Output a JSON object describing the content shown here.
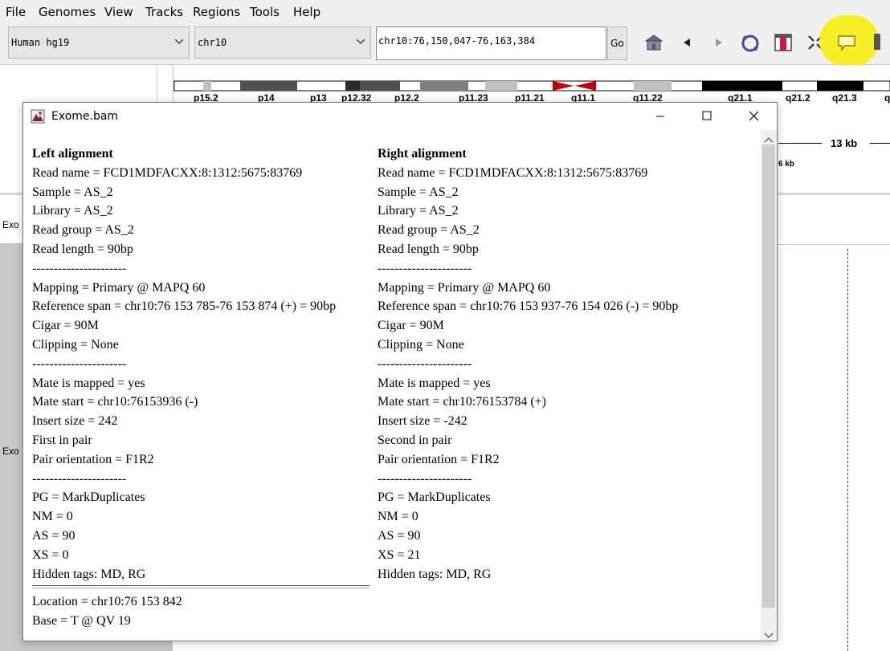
{
  "menu": [
    "File",
    "Genomes",
    "View",
    "Tracks",
    "Regions",
    "Tools",
    "Help"
  ],
  "toolbar": {
    "genome": "Human hg19",
    "chromosome": "chr10",
    "locus": "chr10:76,150,047-76,163,384",
    "go_label": "Go",
    "icons": [
      "home-icon",
      "back-icon",
      "forward-icon",
      "refresh-icon",
      "region-of-interest-icon",
      "resize-icon",
      "popup-info-icon"
    ]
  },
  "ideogram": {
    "bands": [
      "p15.2",
      "p14",
      "p13",
      "p12.32",
      "p12.2",
      "p11.23",
      "p11.21",
      "q11.1",
      "q11.22",
      "q21.1",
      "q21.2",
      "q21.3",
      "q"
    ],
    "ruler_label": "13 kb",
    "ruler_tick": "6 kb"
  },
  "tracks": {
    "left_label_1": "Exo",
    "left_label_2": "Exo"
  },
  "popup": {
    "title": "Exome.bam",
    "left": {
      "heading": "Left alignment",
      "read_name": "Read name = FCD1MDFACXX:8:1312:5675:83769",
      "sample": "Sample = AS_2",
      "library": "Library = AS_2",
      "read_group": "Read group = AS_2",
      "read_length": "Read length = 90bp",
      "sep1": "----------------------",
      "mapping": "Mapping = Primary @ MAPQ 60",
      "reference_span": "Reference span = chr10:76 153 785-76 153 874 (+) = 90bp",
      "cigar": "Cigar = 90M",
      "clipping": "Clipping = None",
      "sep2": "----------------------",
      "mate_mapped": "Mate is mapped = yes",
      "mate_start": "Mate start = chr10:76153936 (-)",
      "insert_size": "Insert size = 242",
      "pair": "First in pair",
      "pair_orientation": "Pair orientation = F1R2",
      "sep3": "----------------------",
      "pg": "PG = MarkDuplicates",
      "nm": "NM = 0",
      "as": "AS = 90",
      "xs": "XS = 0",
      "hidden_tags": "Hidden tags: MD, RG",
      "location": "Location = chr10:76 153 842",
      "base": "Base = T @ QV 19"
    },
    "right": {
      "heading": "Right alignment",
      "read_name": "Read name = FCD1MDFACXX:8:1312:5675:83769",
      "sample": "Sample = AS_2",
      "library": "Library = AS_2",
      "read_group": "Read group = AS_2",
      "read_length": "Read length = 90bp",
      "sep1": "----------------------",
      "mapping": "Mapping = Primary @ MAPQ 60",
      "reference_span": "Reference span = chr10:76 153 937-76 154 026 (-) = 90bp",
      "cigar": "Cigar = 90M",
      "clipping": "Clipping = None",
      "sep2": "----------------------",
      "mate_mapped": "Mate is mapped = yes",
      "mate_start": "Mate start = chr10:76153784 (+)",
      "insert_size": "Insert size = -242",
      "pair": "Second in pair",
      "pair_orientation": "Pair orientation = F1R2",
      "sep3": "----------------------",
      "pg": "PG = MarkDuplicates",
      "nm": "NM = 0",
      "as": "AS = 90",
      "xs": "XS = 21",
      "hidden_tags": "Hidden tags: MD, RG"
    }
  },
  "colors": {
    "highlight": "#f6ee1a",
    "centromere": "#c00000"
  }
}
